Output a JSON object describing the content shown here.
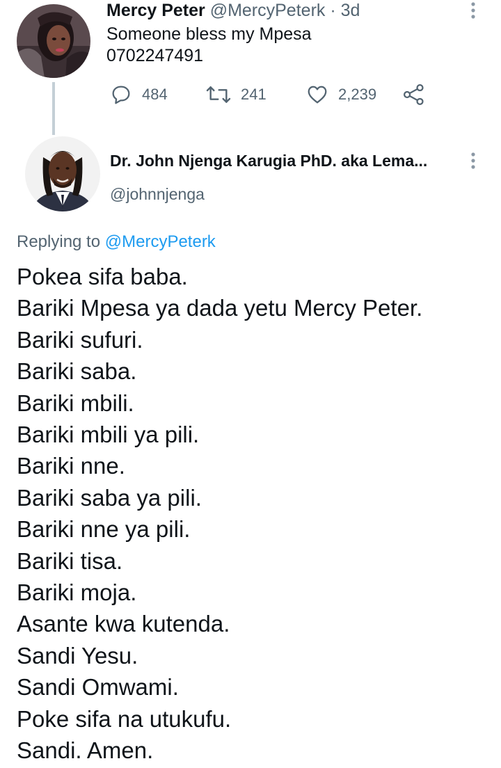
{
  "tweet1": {
    "display_name": "Mercy Peter",
    "meta": "@MercyPeterk · 3d",
    "text_lines": [
      "Someone bless my Mpesa",
      "0702247491"
    ],
    "more_icon": "more-vertical-icon",
    "actions": {
      "reply": {
        "icon": "reply-icon",
        "count": "484"
      },
      "retweet": {
        "icon": "retweet-icon",
        "count": "241"
      },
      "like": {
        "icon": "heart-icon",
        "count": "2,239"
      },
      "share": {
        "icon": "share-icon"
      }
    }
  },
  "tweet2": {
    "display_name": "Dr. John Njenga Karugia PhD. aka Lema...",
    "handle": "@johnnjenga",
    "more_icon": "more-vertical-icon",
    "replying_prefix": "Replying to ",
    "replying_mention": "@MercyPeterk",
    "body_lines": [
      "Pokea sifa baba.",
      "Bariki Mpesa ya dada yetu Mercy Peter.",
      "Bariki sufuri.",
      "Bariki saba.",
      "Bariki mbili.",
      "Bariki mbili ya pili.",
      "Bariki nne.",
      "Bariki saba ya pili.",
      "Bariki nne ya pili.",
      "Bariki tisa.",
      "Bariki moja.",
      "Asante kwa kutenda.",
      "Sandi Yesu.",
      "Sandi Omwami.",
      "Poke sifa na utukufu.",
      "Sandi. Amen."
    ]
  },
  "colors": {
    "text": "#0f1419",
    "secondary": "#536471",
    "link": "#1d9bf0",
    "thread_line": "#c4cfd6"
  }
}
